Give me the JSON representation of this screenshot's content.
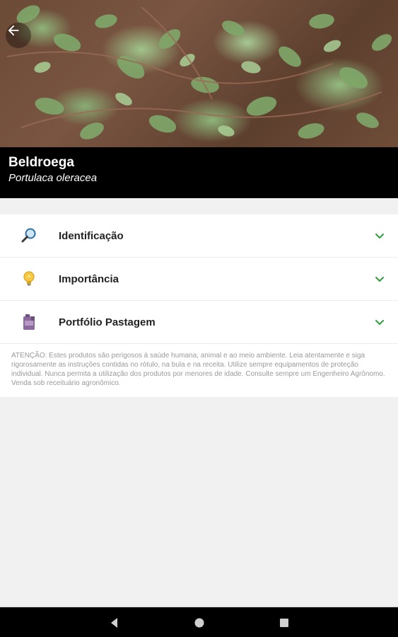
{
  "header": {
    "common_name": "Beldroega",
    "scientific_name": "Portulaca oleracea"
  },
  "sections": [
    {
      "icon": "magnifier-icon",
      "label": "Identificação"
    },
    {
      "icon": "lightbulb-icon",
      "label": "Importância"
    },
    {
      "icon": "product-jug-icon",
      "label": "Portfólio Pastagem"
    }
  ],
  "disclaimer": "ATENÇÃO: Estes produtos são perigosos à saúde humana, animal e ao meio ambiente. Leia atentamente e siga rigorosamente as instruções contidas no rótulo, na bula e na receita. Utilize sempre equipamentos de proteção individual. Nunca permita a utilização dos produtos por menores de idade. Consulte sempre um Engenheiro Agrônomo. Venda sob receituário agronômico.",
  "colors": {
    "accent": "#2e9e3e",
    "title_bg": "#000000",
    "page_bg": "#f1f1f1"
  }
}
